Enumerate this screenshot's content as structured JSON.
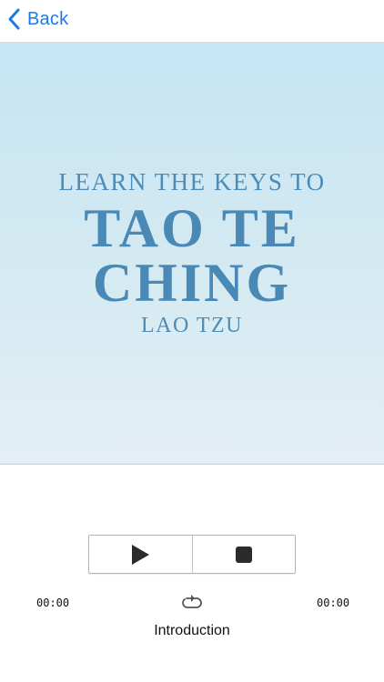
{
  "nav": {
    "back_label": "Back"
  },
  "cover": {
    "subtitle": "LEARN THE KEYS TO",
    "title_line1": "TAO TE",
    "title_line2": "CHING",
    "author": "LAO TZU"
  },
  "player": {
    "play_icon": "play-icon",
    "stop_icon": "stop-icon",
    "repeat_icon": "repeat-icon",
    "elapsed": "00:00",
    "duration": "00:00",
    "track_title": "Introduction"
  },
  "colors": {
    "accent": "#1b7ae6",
    "cover_text": "#4a89b5"
  }
}
